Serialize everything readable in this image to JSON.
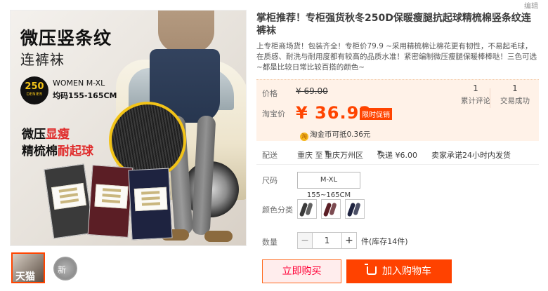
{
  "gallery": {
    "title_line1": "微压竖条纹",
    "title_line2": "连裤袜",
    "denier_num": "250",
    "denier_unit": "DENIER",
    "women_size": "WOMEN  M-XL",
    "height_range": "均码155-165CM",
    "promo_line1_a": "微压",
    "promo_line1_b": "显瘦",
    "promo_line2_a": "精梳棉",
    "promo_line2_b": "耐起球",
    "thumb1_text": "天猫",
    "thumb2_text": "新"
  },
  "header": {
    "edit_link": "编辑",
    "title": "掌柜推荐！专柜强货秋冬250D保暖瘦腿抗起球精梳棉竖条纹连裤袜",
    "description": "上专柜商场货！包装齐全！专柜价79.9 ~采用精梳棉让棉花更有韧性，不易起毛球，在质感、耐洗与耐用度都有较高的品质水准！紧密编制微压瘦腿保暖棒棒哒！三色可选~都是比较日常比较百搭的颜色~"
  },
  "price": {
    "orig_label": "价格",
    "orig_value": "¥ 69.00",
    "real_label": "淘宝价",
    "real_value": "¥ 36.92",
    "promo_tag": "限时促销",
    "reviews_count": "1",
    "reviews_label": "累计评论",
    "sales_count": "1",
    "sales_label": "交易成功",
    "coin_icon": "淘",
    "coin_text": "淘金币可抵0.36元"
  },
  "shipping": {
    "label": "配送",
    "from": "重庆 至",
    "to": "重庆万州区",
    "method": "快递 ¥6.00",
    "promise": "卖家承诺24小时内发货",
    "caret": "▼"
  },
  "options": {
    "size_label": "尺码",
    "size_value": "M-XL 155~165CM",
    "color_label": "颜色分类",
    "swatch_colors": [
      "#3a3a3a",
      "#5b1e25",
      "#1e2340"
    ]
  },
  "quantity": {
    "label": "数量",
    "minus": "−",
    "value": "1",
    "plus": "+",
    "stock": "件(库存14件)"
  },
  "actions": {
    "buy_now": "立即购买",
    "add_cart": "加入购物车"
  }
}
